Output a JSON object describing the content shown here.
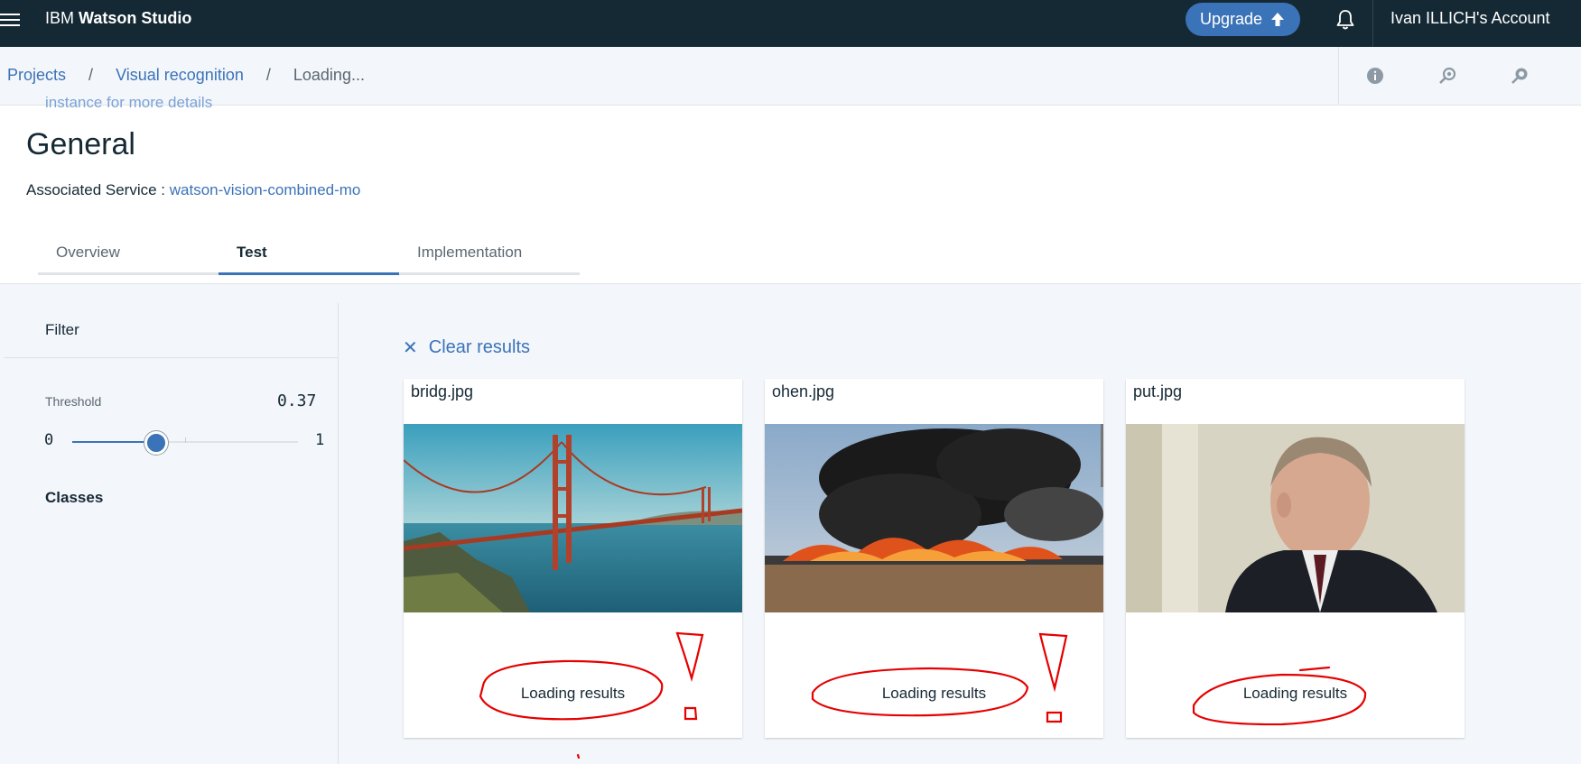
{
  "topbar": {
    "brand_prefix": "IBM",
    "brand_name": "Watson Studio",
    "upgrade_label": "Upgrade",
    "account_label": "Ivan ILLICH's Account"
  },
  "breadcrumb": {
    "items": [
      "Projects",
      "Visual recognition",
      "Loading..."
    ],
    "separator": "/"
  },
  "header": {
    "cut_text": "instance for more details",
    "title": "General",
    "assoc_label": "Associated Service :",
    "assoc_link": "watson-vision-combined-mo",
    "tabs": [
      {
        "label": "Overview",
        "active": false
      },
      {
        "label": "Test",
        "active": true
      },
      {
        "label": "Implementation",
        "active": false
      }
    ]
  },
  "filter": {
    "title": "Filter",
    "threshold_label": "Threshold",
    "threshold_value": 0.37,
    "min": "0",
    "max": "1",
    "classes_label": "Classes"
  },
  "results": {
    "clear_label": "Clear results",
    "cards": [
      {
        "filename": "bridg.jpg",
        "status": "Loading results",
        "image": "golden-gate-bridge-photo"
      },
      {
        "filename": "ohen.jpg",
        "status": "Loading results",
        "image": "car-park-fire-photo"
      },
      {
        "filename": "put.jpg",
        "status": "Loading results",
        "image": "man-in-suit-portrait-photo"
      }
    ]
  },
  "colors": {
    "topbar": "#152935",
    "accent": "#3b73b9",
    "annotation": "#e60000"
  }
}
